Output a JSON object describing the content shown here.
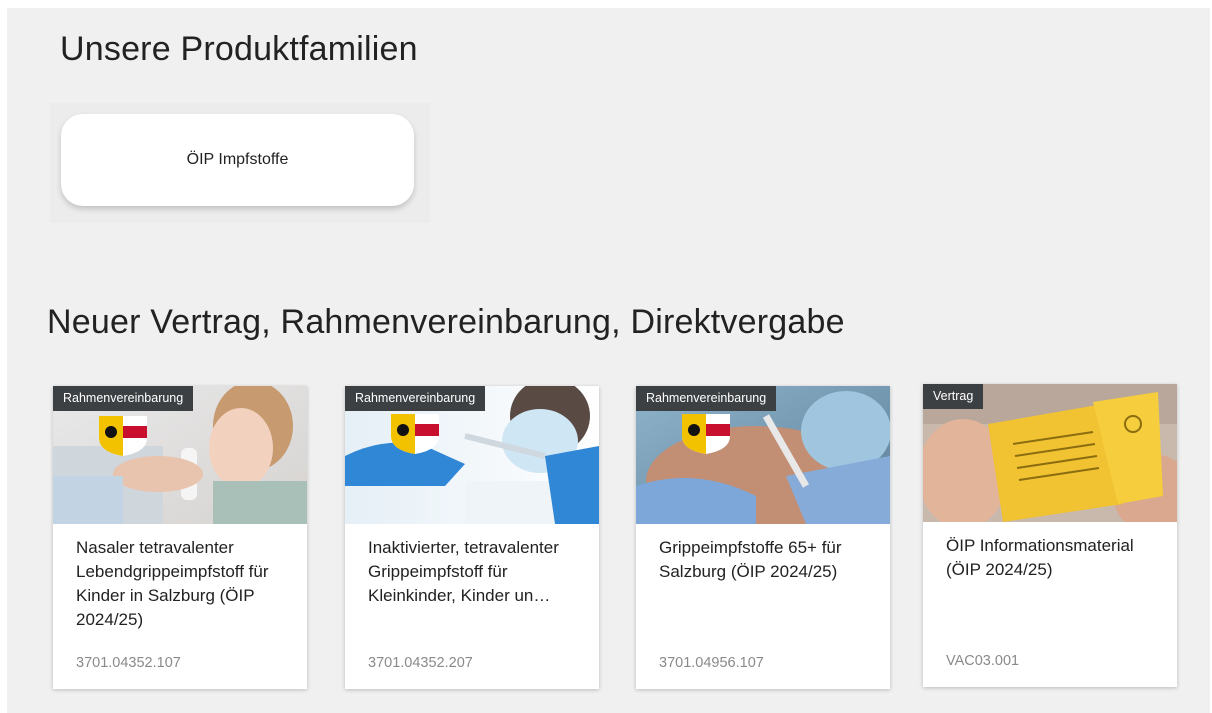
{
  "sections": {
    "families_title": "Unsere Produktfamilien",
    "contracts_title": "Neuer Vertrag, Rahmenvereinbarung, Direktvergabe"
  },
  "families": [
    {
      "label": "ÖIP Impfstoffe"
    }
  ],
  "cards": [
    {
      "badge": "Rahmenvereinbarung",
      "title": "Nasaler tetravalenter Lebendgrippeimpfstoff für Kinder in Salzburg (ÖIP 2024/25)",
      "code": "3701.04352.107",
      "image": "child-nasal-spray-photo"
    },
    {
      "badge": "Rahmenvereinbarung",
      "title": "Inaktivierter, tetravalenter Grippeimpfstoff für Kleinkinder, Kinder un…",
      "code": "3701.04352.207",
      "image": "doctor-syringe-photo"
    },
    {
      "badge": "Rahmenvereinbarung",
      "title": "Grippeimpfstoffe 65+ für Salzburg (ÖIP 2024/25)",
      "code": "3701.04956.107",
      "image": "shoulder-injection-photo"
    },
    {
      "badge": "Vertrag",
      "title": "ÖIP Informationsmaterial (ÖIP 2024/25)",
      "code": "VAC03.001",
      "image": "vaccination-booklet-photo"
    }
  ],
  "colors": {
    "panel_bg": "#f0f0f0",
    "badge_bg": "#3c4043",
    "code_text": "#8a8a8a"
  }
}
